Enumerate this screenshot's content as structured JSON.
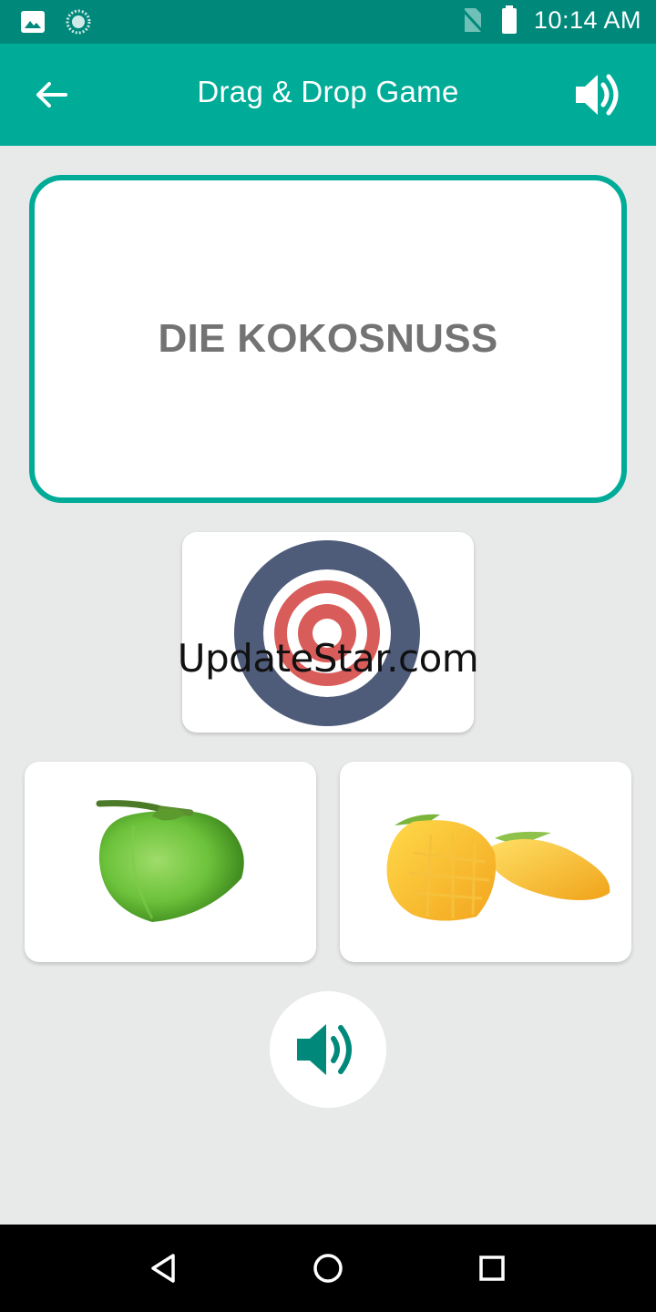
{
  "status_bar": {
    "time": "10:14 AM",
    "icons": [
      "image-icon",
      "loading-icon",
      "no-sim-icon",
      "battery-icon"
    ]
  },
  "app_bar": {
    "title": "Drag & Drop Game",
    "icons": [
      "back-arrow-icon",
      "volume-icon"
    ]
  },
  "word_card": {
    "word": "DIE KOKOSNUSS"
  },
  "drop_target": {
    "icon": "target-icon"
  },
  "watermark": "UpdateStar.com",
  "options": [
    {
      "name": "coconut",
      "icon": "coconut-image"
    },
    {
      "name": "mango",
      "icon": "mango-image"
    }
  ],
  "controls": {
    "sound_icon": "volume-icon"
  },
  "nav_bar": {
    "icons": [
      "back-triangle-icon",
      "home-circle-icon",
      "recents-square-icon"
    ]
  },
  "colors": {
    "primary": "#00ac97",
    "status_bar": "#00897b",
    "background": "#e8e9e9",
    "word_text": "#737373",
    "target_outer": "#4e5b79",
    "target_red": "#d85c5a"
  }
}
